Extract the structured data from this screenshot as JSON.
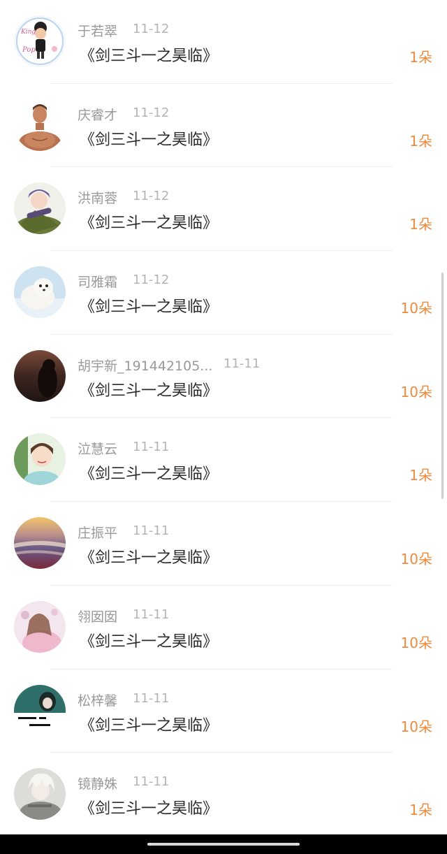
{
  "items": [
    {
      "name": "于若翠",
      "date": "11-12",
      "title": "《剑三斗一之昊临》",
      "count": "1朵",
      "avatar_icon": "cartoon-doll-avatar-icon"
    },
    {
      "name": "庆睿才",
      "date": "11-12",
      "title": "《剑三斗一之昊临》",
      "count": "1朵",
      "avatar_icon": "muscular-man-avatar-icon"
    },
    {
      "name": "洪南蓉",
      "date": "11-12",
      "title": "《剑三斗一之昊临》",
      "count": "1朵",
      "avatar_icon": "girl-hat-avatar-icon"
    },
    {
      "name": "司雅霜",
      "date": "11-12",
      "title": "《剑三斗一之昊临》",
      "count": "10朵",
      "avatar_icon": "seal-avatar-icon"
    },
    {
      "name": "胡宇新_191442105...",
      "date": "11-11",
      "title": "《剑三斗一之昊临》",
      "count": "10朵",
      "avatar_icon": "sunset-silhouette-avatar-icon"
    },
    {
      "name": "泣慧云",
      "date": "11-11",
      "title": "《剑三斗一之昊临》",
      "count": "1朵",
      "avatar_icon": "smiling-girl-avatar-icon"
    },
    {
      "name": "庄振平",
      "date": "11-11",
      "title": "《剑三斗一之昊临》",
      "count": "10朵",
      "avatar_icon": "beach-sunset-avatar-icon"
    },
    {
      "name": "翎囡囡",
      "date": "11-11",
      "title": "《剑三斗一之昊临》",
      "count": "10朵",
      "avatar_icon": "anime-girl-avatar-icon"
    },
    {
      "name": "松梓馨",
      "date": "11-11",
      "title": "《剑三斗一之昊临》",
      "count": "10朵",
      "avatar_icon": "calligraphy-girl-avatar-icon"
    },
    {
      "name": "镜静姝",
      "date": "11-11",
      "title": "《剑三斗一之昊临》",
      "count": "1朵",
      "avatar_icon": "white-hair-anime-avatar-icon"
    }
  ],
  "colors": {
    "count": "#ee8a3c",
    "name": "#9a9a9a",
    "date": "#b4b4b4",
    "title": "#2a2a2a"
  }
}
